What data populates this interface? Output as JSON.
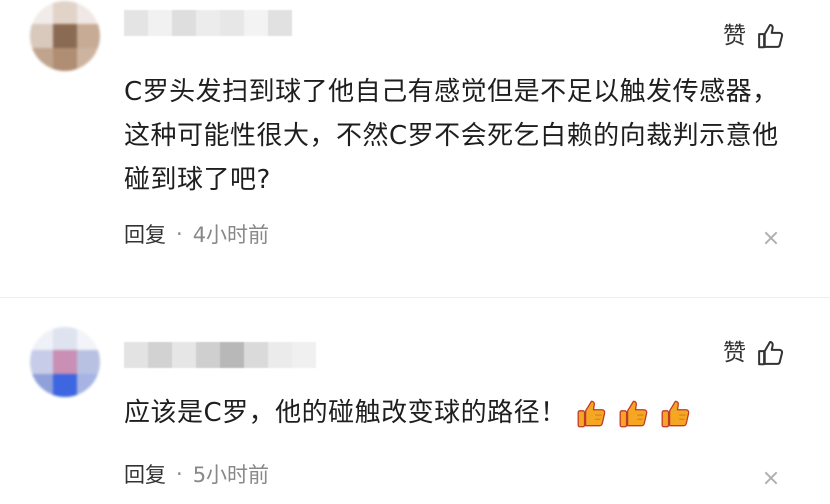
{
  "comments": [
    {
      "like_label": "赞",
      "text": "C罗头发扫到球了他自己有感觉但是不足以触发传感器，这种可能性很大，不然C罗不会死乞白赖的向裁判示意他碰到球了吧?",
      "reply_label": "回复",
      "separator": "·",
      "time": "4小时前"
    },
    {
      "like_label": "赞",
      "text": "应该是C罗，他的碰触改变球的路径！",
      "emojis": [
        "thumbs-up-emoji",
        "thumbs-up-emoji",
        "thumbs-up-emoji"
      ],
      "reply_label": "回复",
      "separator": "·",
      "time": "5小时前"
    }
  ],
  "colors": {
    "text": "#1e1e1e",
    "meta": "#888888",
    "emoji_fill": "#f5a623",
    "emoji_outline": "#c0392b"
  },
  "icons": [
    "thumbs-up-icon",
    "close-icon"
  ]
}
